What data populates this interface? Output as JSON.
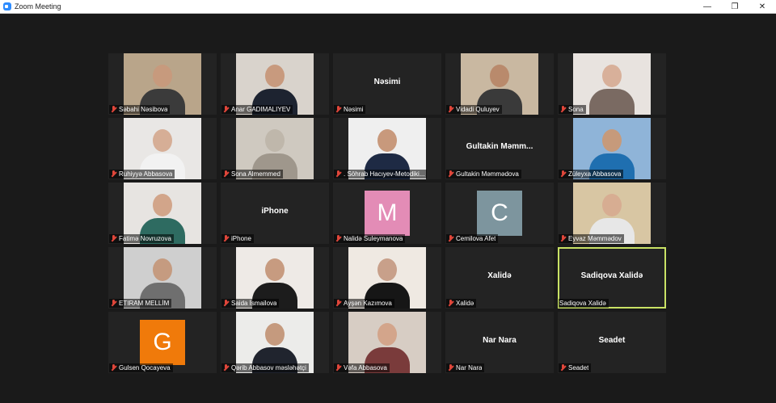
{
  "window": {
    "title": "Zoom Meeting",
    "minimize": "—",
    "maximize": "❐",
    "close": "✕"
  },
  "participants": [
    {
      "label": "Səbahi Nəsibova",
      "kind": "video",
      "bg": "#b9a58a",
      "skin": "#c79a7d",
      "shirt": "#3b3b3b"
    },
    {
      "label": "Anar GADIMALIYEV",
      "kind": "video",
      "bg": "#d9d3cc",
      "skin": "#c89a7e",
      "shirt": "#1d2330"
    },
    {
      "label": "Nəsimi",
      "kind": "name",
      "title": "Nəsimi"
    },
    {
      "label": "Vidadi Quluyev",
      "kind": "video",
      "bg": "#c9b8a1",
      "skin": "#b98a6c",
      "shirt": "#3a3a3a"
    },
    {
      "label": "Sona",
      "kind": "video",
      "bg": "#e8e3df",
      "skin": "#d8b09a",
      "shirt": "#7a6a62"
    },
    {
      "label": "Ruhiyyə Abbasova",
      "kind": "video",
      "bg": "#e9e7e5",
      "skin": "#d6ae96",
      "shirt": "#f2f2f2"
    },
    {
      "label": "Sona Almemmed",
      "kind": "video",
      "bg": "#cfc9c0",
      "skin": "#bfb7ab",
      "shirt": "#9f978c"
    },
    {
      "label": ". Söhrab  Hacıyev-Metodiki...",
      "kind": "video",
      "bg": "#efefef",
      "skin": "#c8997c",
      "shirt": "#1e2a44"
    },
    {
      "label": "Gultakin Məmmədova",
      "kind": "name",
      "title": "Gultakin  Məmm..."
    },
    {
      "label": "Züleyxa Abbasova",
      "kind": "video",
      "bg": "#8fb4d8",
      "skin": "#c69a7b",
      "shirt": "#1f6fb0"
    },
    {
      "label": "Fatimə Novruzova",
      "kind": "video",
      "bg": "#e7e4e1",
      "skin": "#d2a58a",
      "shirt": "#2e6b61"
    },
    {
      "label": "iPhone",
      "kind": "name",
      "title": "iPhone"
    },
    {
      "label": "Nalidə Suleymanova",
      "kind": "initial",
      "initial": "M",
      "color": "#e38cb6"
    },
    {
      "label": "Cemilova Afet",
      "kind": "initial",
      "initial": "C",
      "color": "#7d959e"
    },
    {
      "label": "Eyvaz Məmmədov",
      "kind": "video",
      "bg": "#d8c6a3",
      "skin": "#d7ad92",
      "shirt": "#e7e7e7"
    },
    {
      "label": "ETIRAM MELLİM",
      "kind": "video",
      "bg": "#cfcfcf",
      "skin": "#c59b80",
      "shirt": "#6f6f6f"
    },
    {
      "label": "Saida İsmailova",
      "kind": "video",
      "bg": "#eeeae6",
      "skin": "#c79b80",
      "shirt": "#1c1c1c"
    },
    {
      "label": "Ayşən Kazımova",
      "kind": "video",
      "bg": "#efe9e2",
      "skin": "#c8a08a",
      "shirt": "#161616"
    },
    {
      "label": "Xalidə",
      "kind": "name",
      "title": "Xalidə"
    },
    {
      "label": "Sadiqova Xalidə",
      "kind": "name",
      "title": "Sadiqova Xalidə",
      "active": true
    },
    {
      "label": "Gulsen Qocayeva",
      "kind": "initial",
      "initial": "G",
      "color": "#f07a0a"
    },
    {
      "label": "Qərib Abbasov məsləhətçi",
      "kind": "video",
      "bg": "#ececea",
      "skin": "#c59a7e",
      "shirt": "#20242e"
    },
    {
      "label": "Vəfa Abbasova",
      "kind": "video",
      "bg": "#d7cdc4",
      "skin": "#d3a58b",
      "shirt": "#7a3b3b"
    },
    {
      "label": "Nar Nara",
      "kind": "name",
      "title": "Nar Nara"
    },
    {
      "label": "Seadet",
      "kind": "name",
      "title": "Seadet"
    }
  ]
}
